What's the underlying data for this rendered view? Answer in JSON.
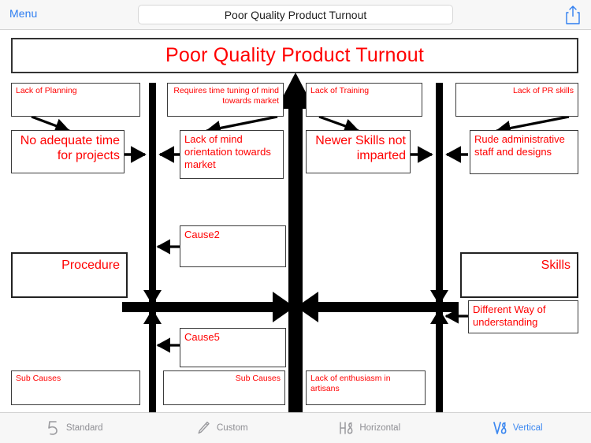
{
  "topbar": {
    "menu_label": "Menu",
    "document_title": "Poor Quality Product Turnout",
    "share_icon": "share-upload-icon"
  },
  "diagram": {
    "banner_title": "Poor Quality Product Turnout",
    "text_color": "#ff0000",
    "line_color": "#000000",
    "boxes": {
      "lack_of_planning": "Lack of Planning",
      "no_adequate_time": "No adequate time for projects",
      "requires_time_tuning": "Requires time tuning of mind towards market",
      "lack_of_mind_orientation": "Lack of mind orientation towards market",
      "lack_of_training": "Lack of Training",
      "newer_skills_not_imparted": "Newer Skills not imparted",
      "lack_of_pr_skills": "Lack of PR skills",
      "rude_administrative": "Rude administrative staff and designs",
      "cause2": "Cause2",
      "procedure": "Procedure",
      "skills": "Skills",
      "different_way": "Different Way of understanding",
      "cause5": "Cause5",
      "sub_causes_left": "Sub Causes",
      "sub_causes_mid": "Sub Causes",
      "lack_of_enthusiasm": "Lack of enthusiasm in artisans"
    }
  },
  "toolbar": {
    "items": [
      {
        "label": "Standard",
        "icon": "standard-5-icon",
        "active": false
      },
      {
        "label": "Custom",
        "icon": "pencil-icon",
        "active": false
      },
      {
        "label": "Horizontal",
        "icon": "horizontal-h8-icon",
        "active": false
      },
      {
        "label": "Vertical",
        "icon": "vertical-v8-icon",
        "active": true
      }
    ],
    "active_color": "#3b87f0",
    "inactive_color": "#8e8e93"
  }
}
